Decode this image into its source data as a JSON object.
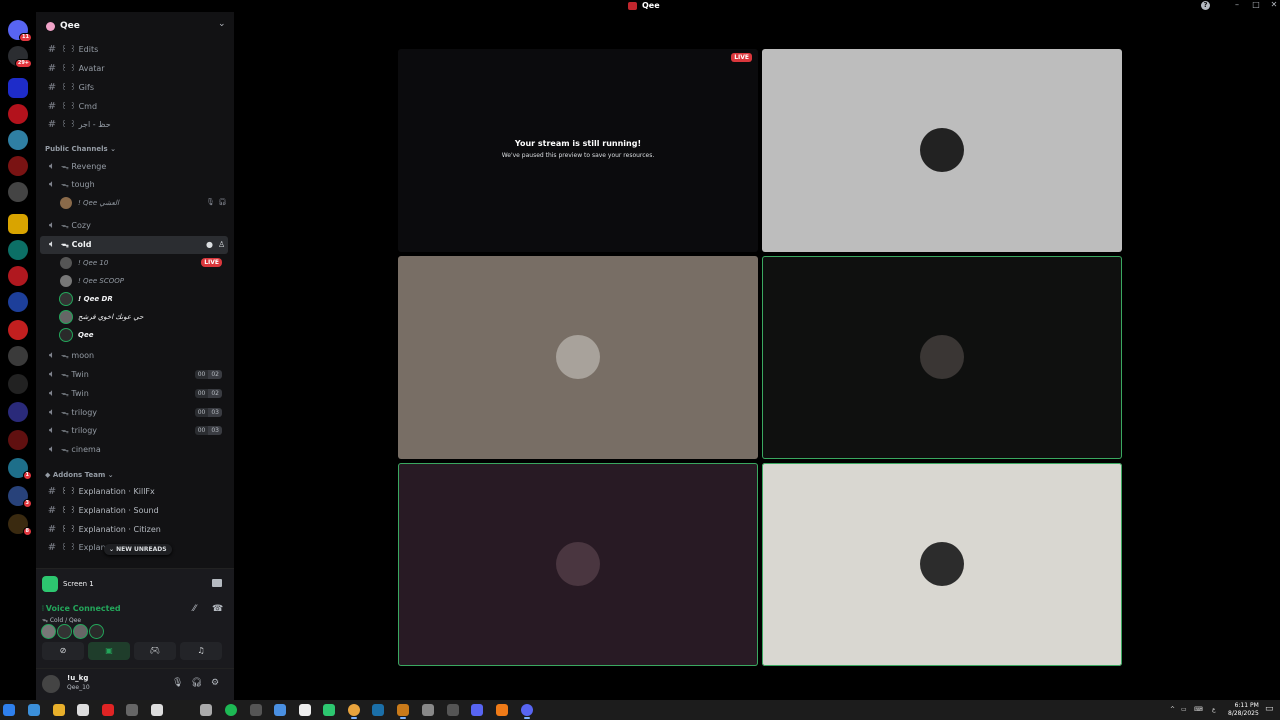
{
  "window": {
    "title": "Qee"
  },
  "server_rail": {
    "mentions_badge": "11",
    "inbox_badge": "29+",
    "badges": [
      "1",
      "3",
      "8"
    ]
  },
  "sidebar": {
    "server_name": "Qee",
    "text_channels": [
      {
        "icon": "hash-icon",
        "label": "꒰ ꒱ Edits"
      },
      {
        "icon": "hash-icon",
        "label": "꒰ ꒱ Avatar"
      },
      {
        "icon": "hash-icon",
        "label": "꒰ ꒱ Gifs"
      },
      {
        "icon": "hash-icon",
        "label": "꒰ ꒱ Cmd"
      },
      {
        "icon": "hash-icon",
        "label": "꒰ ꒱ حظ - اجر"
      }
    ],
    "public_category": "Public Channels",
    "voice_channels": [
      {
        "label": "ᯓ Revenge"
      },
      {
        "label": "ᯓ tough"
      },
      {
        "label": "ᯓ Cozy"
      },
      {
        "label": "ᯓ Cold"
      },
      {
        "label": "ᯓ moon"
      },
      {
        "label": "ᯓ Twin",
        "count_a": "00",
        "count_b": "02"
      },
      {
        "label": "ᯓ Twin",
        "count_a": "00",
        "count_b": "02"
      },
      {
        "label": "ᯓ trilogy",
        "count_a": "00",
        "count_b": "03"
      },
      {
        "label": "ᯓ trilogy",
        "count_a": "00",
        "count_b": "03"
      },
      {
        "label": "ᯓ cinema"
      }
    ],
    "tough_member": "! Qee العشي",
    "cold_members": [
      {
        "name": "! Qee 10",
        "live": "LIVE"
      },
      {
        "name": "! Qee SCOOP"
      },
      {
        "name": "! Qee DR"
      },
      {
        "name": "حي عونك اخوي فرشح"
      },
      {
        "name": "Qee"
      }
    ],
    "addons_category": "Addons Team",
    "addons_channels": [
      {
        "label": "꒰ ꒱ Explanation · KillFx"
      },
      {
        "label": "꒰ ꒱ Explanation · Sound"
      },
      {
        "label": "꒰ ꒱ Explanation · Citizen"
      },
      {
        "label": "꒰ ꒱ Explanation · Fx"
      }
    ],
    "new_unreads": "NEW UNREADS"
  },
  "screen_share": {
    "label": "Screen 1"
  },
  "voice": {
    "status": "Voice Connected",
    "channel": "ᯓ Cold / Qee"
  },
  "user": {
    "name": "!u_kg",
    "status": "Qee_10"
  },
  "stage": {
    "paused_title": "Your stream is still running!",
    "paused_subtitle": "We've paused this preview to save your resources.",
    "live_badge": "LIVE",
    "tiles": [
      {
        "bg": "#0b0b0d",
        "type": "stream"
      },
      {
        "bg": "#bdbdbd",
        "avatar": "#222222"
      },
      {
        "bg": "#786e65",
        "avatar": "#a8a29b"
      },
      {
        "bg": "#0f100f",
        "avatar": "#3a3634",
        "speaking": true
      },
      {
        "bg": "#281a24",
        "avatar": "#4a3640",
        "speaking": true
      },
      {
        "bg": "#d9d7d1",
        "avatar": "#2c2c2c",
        "speaking": true
      }
    ]
  },
  "taskbar": {
    "time": "6:11 PM",
    "date": "8/28/2025"
  },
  "colors": {
    "accent_green": "#23a55a",
    "live_red": "#da373c",
    "sidebar_bg": "#121214"
  }
}
